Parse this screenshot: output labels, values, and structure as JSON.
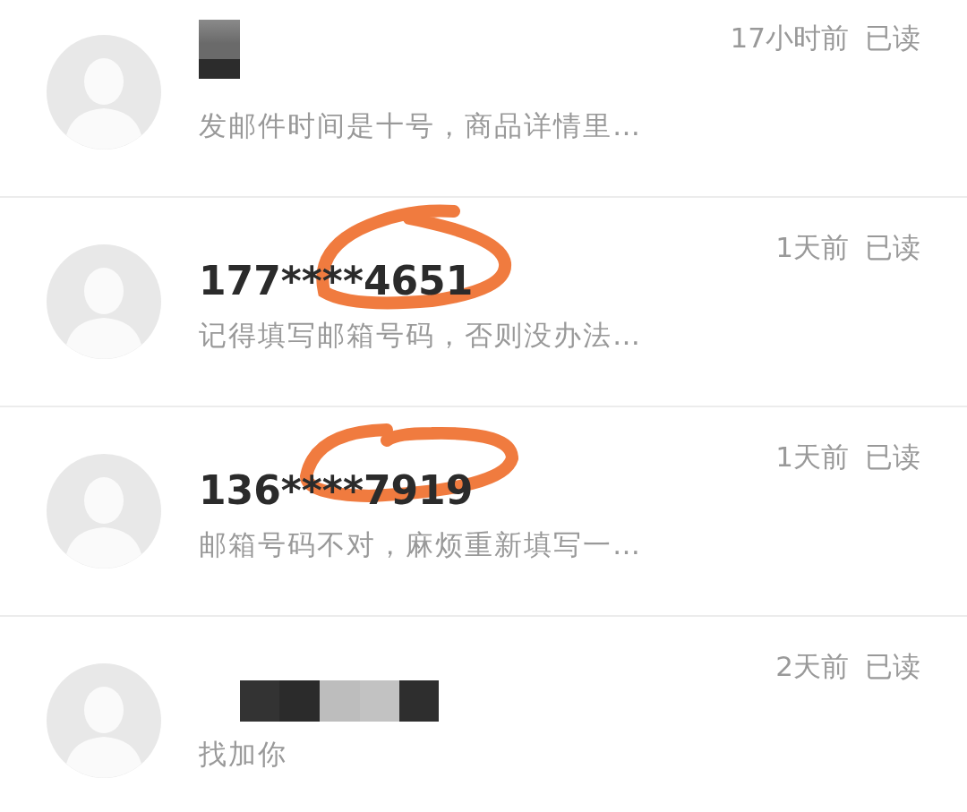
{
  "conversations": [
    {
      "kind": "redacted-short",
      "time": "17小时前",
      "read_status": "已读",
      "preview": "发邮件时间是十号，商品详情里…",
      "circled": false
    },
    {
      "kind": "text",
      "name": "177****4651",
      "time": "1天前",
      "read_status": "已读",
      "preview": "记得填写邮箱号码，否则没办法…",
      "circled": true
    },
    {
      "kind": "text",
      "name": "136****7919",
      "time": "1天前",
      "read_status": "已读",
      "preview": "邮箱号码不对，麻烦重新填写一…",
      "circled": true
    },
    {
      "kind": "redacted-long",
      "time": "2天前",
      "read_status": "已读",
      "preview": "找加你",
      "circled": false
    }
  ]
}
